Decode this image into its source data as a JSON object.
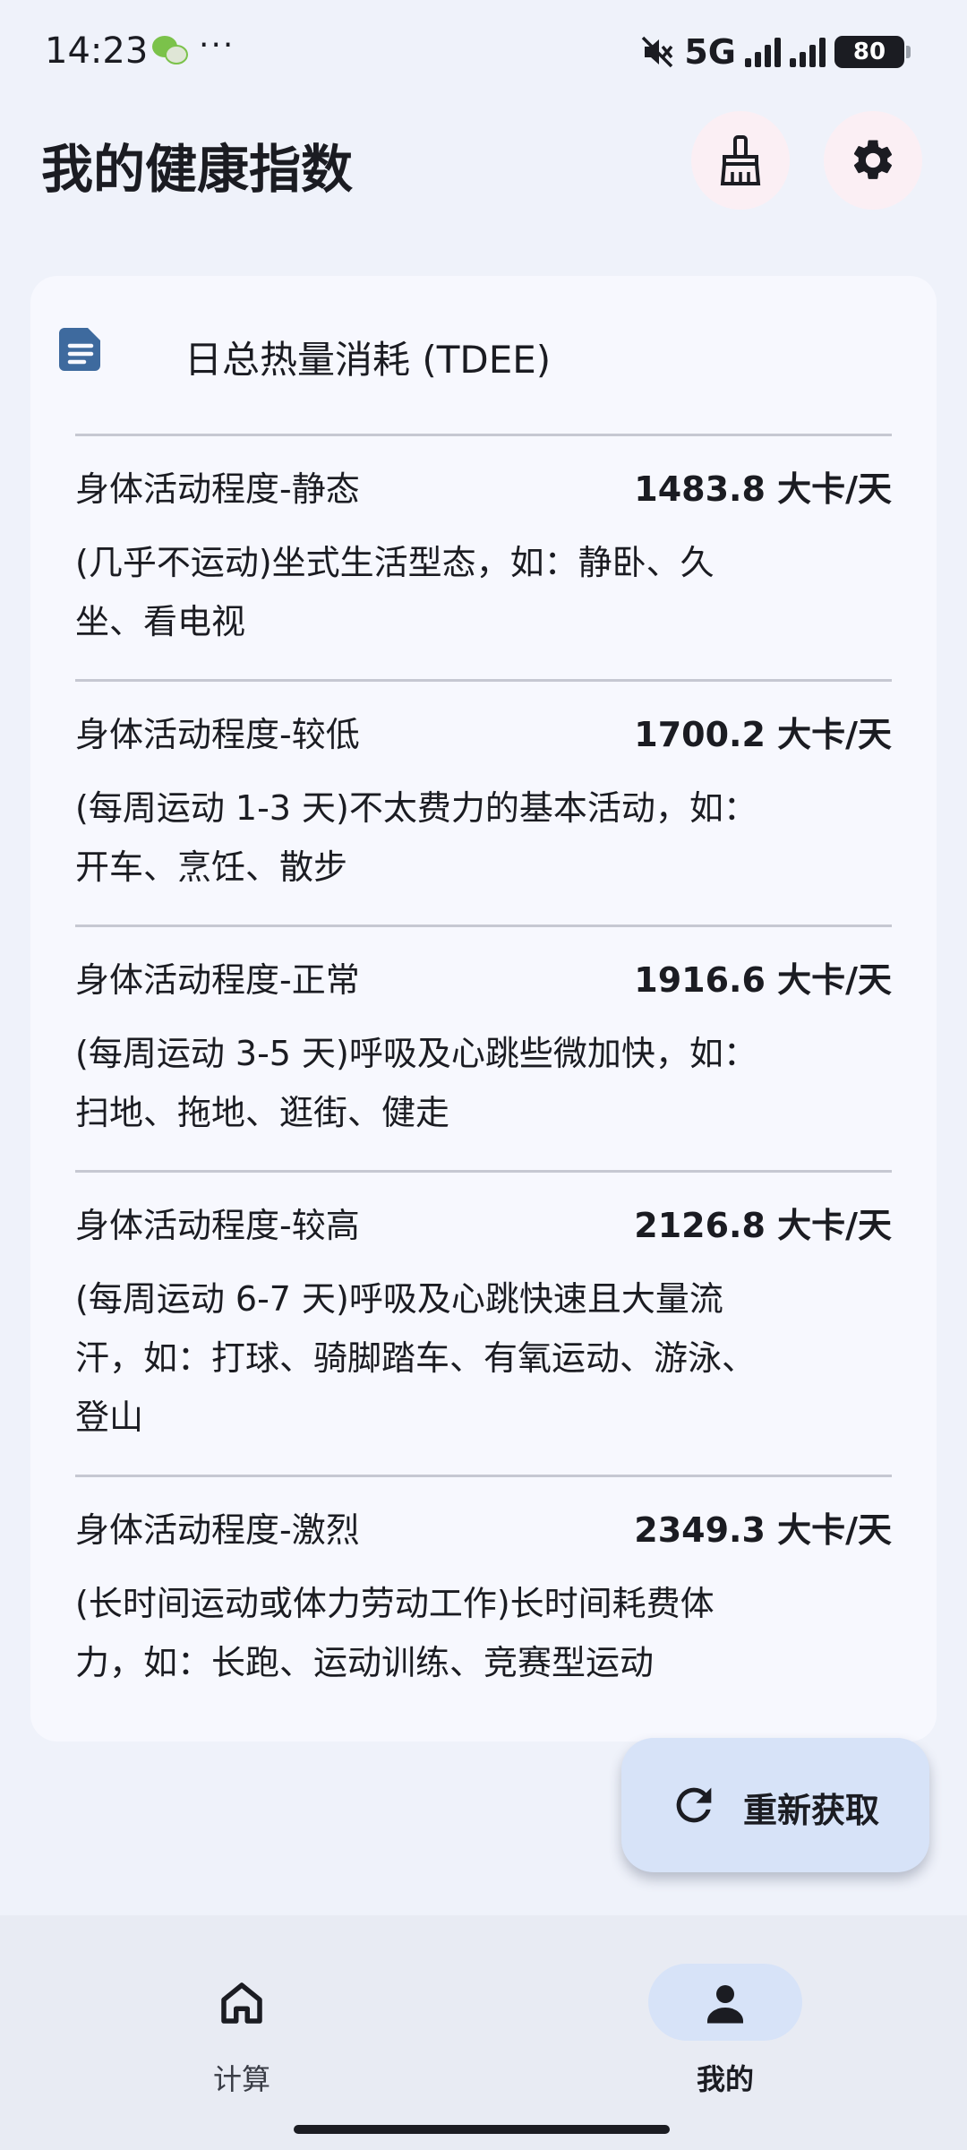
{
  "status_bar": {
    "time": "14:23",
    "dots": "···",
    "network": "5G",
    "battery": "80"
  },
  "app_bar": {
    "title": "我的健康指数"
  },
  "card": {
    "title": "日总热量消耗 (TDEE)",
    "rows": [
      {
        "name": "身体活动程度-静态",
        "value": "1483.8 大卡/天",
        "desc_line1": "(几乎不运动)坐式生活型态，如：静卧、久",
        "desc_line2": "坐、看电视",
        "desc_line3": ""
      },
      {
        "name": "身体活动程度-较低",
        "value": "1700.2 大卡/天",
        "desc_line1": "(每周运动 1-3 天)不太费力的基本活动，如：",
        "desc_line2": "开车、烹饪、散步",
        "desc_line3": ""
      },
      {
        "name": "身体活动程度-正常",
        "value": "1916.6 大卡/天",
        "desc_line1": "(每周运动 3-5 天)呼吸及心跳些微加快，如：",
        "desc_line2": "扫地、拖地、逛街、健走",
        "desc_line3": ""
      },
      {
        "name": "身体活动程度-较高",
        "value": "2126.8 大卡/天",
        "desc_line1": "(每周运动 6-7 天)呼吸及心跳快速且大量流",
        "desc_line2": "汗，如：打球、骑脚踏车、有氧运动、游泳、",
        "desc_line3": "登山"
      },
      {
        "name": "身体活动程度-激烈",
        "value": "2349.3 大卡/天",
        "desc_line1": "(长时间运动或体力劳动工作)长时间耗费体",
        "desc_line2": "力，如：长跑、运动训练、竞赛型运动",
        "desc_line3": ""
      }
    ]
  },
  "fab": {
    "label": "重新获取",
    "icon": "refresh-icon"
  },
  "bottom_nav": {
    "items": [
      {
        "label": "计算",
        "icon": "home-icon"
      },
      {
        "label": "我的",
        "icon": "person-icon"
      }
    ]
  },
  "colors": {
    "background": "#eff2fa",
    "card": "#f7f8fe",
    "accent_container": "#d7e3f8",
    "round_button": "#fbeff4",
    "doc_icon": "#3e6a9e"
  }
}
